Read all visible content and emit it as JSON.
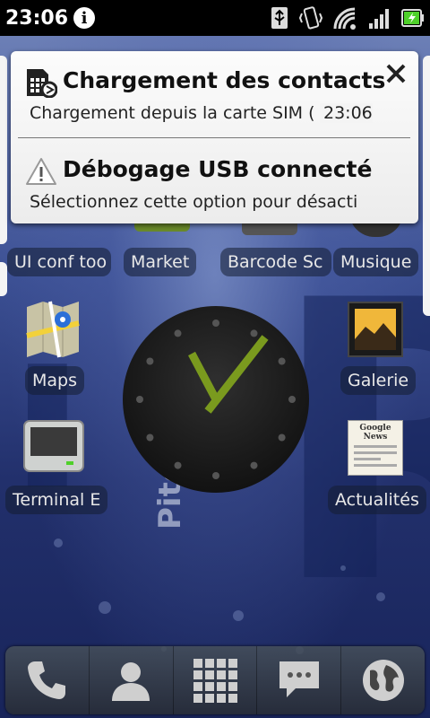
{
  "status_bar": {
    "time": "23:06",
    "icons": [
      "info-icon",
      "usb-icon",
      "vibrate-icon",
      "wifi-icon",
      "signal-icon",
      "battery-charging-icon"
    ]
  },
  "notifications": [
    {
      "icon": "sim-card-icon",
      "title": "Chargement des contacts",
      "text": "Chargement depuis la carte SIM (",
      "time": "23:06"
    },
    {
      "icon": "warning-icon",
      "title": "Débogage USB connecté",
      "text": "Sélectionnez cette option pour désactiv"
    }
  ],
  "apps": {
    "ui_conf": "UI conf too",
    "market": "Market",
    "barcode": "Barcode Sc",
    "musique": "Musique",
    "maps": "Maps",
    "galerie": "Galerie",
    "terminal": "Terminal E",
    "actualites": "Actualités"
  },
  "news_icon_text": "Google News",
  "wallpaper_text": "Piter",
  "dock": [
    "phone-icon",
    "contacts-icon",
    "app-drawer-icon",
    "messaging-icon",
    "browser-icon"
  ],
  "colors": {
    "clock_hands": "#7a9a1e",
    "battery": "#4fd02a"
  }
}
